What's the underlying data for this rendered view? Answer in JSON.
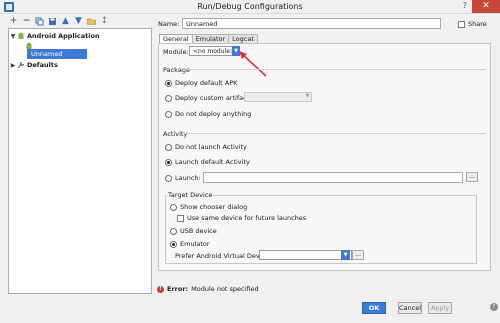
{
  "window": {
    "title": "Run/Debug Configurations",
    "close": "✕",
    "question": "?"
  },
  "toolbar": {
    "icons": [
      "plus-icon",
      "minus-icon",
      "copy-icon",
      "save-icon",
      "up-icon",
      "down-icon",
      "folder-icon",
      "sort-icon"
    ]
  },
  "tree": {
    "android_app": "Android Application",
    "unnamed": "Unnamed",
    "defaults": "Defaults"
  },
  "name": {
    "label": "Name:",
    "value": "Unnamed"
  },
  "share": {
    "label": "Share"
  },
  "tabs": [
    "General",
    "Emulator",
    "Logcat"
  ],
  "module": {
    "label": "Module:",
    "value": "<no module>"
  },
  "package": {
    "title": "Package",
    "options": [
      "Deploy default APK",
      "Deploy custom artifact",
      "Do not deploy anything"
    ],
    "selected": 0
  },
  "activity": {
    "title": "Activity",
    "options": [
      "Do not launch Activity",
      "Launch default Activity",
      "Launch:"
    ],
    "selected": 1
  },
  "target": {
    "title": "Target Device",
    "show_chooser": "Show chooser dialog",
    "use_same": "Use same device for future launches",
    "usb": "USB device",
    "emulator": "Emulator",
    "prefer_avd": "Prefer Android Virtual Device:",
    "selected": "emulator"
  },
  "error": {
    "label": "Error:",
    "message": "Module not specified"
  },
  "buttons": {
    "ok": "OK",
    "cancel": "Cancel",
    "apply": "Apply"
  },
  "colors": {
    "accent": "#3d7ad6",
    "error": "#d43b2c",
    "arrow": "#e0302a"
  }
}
